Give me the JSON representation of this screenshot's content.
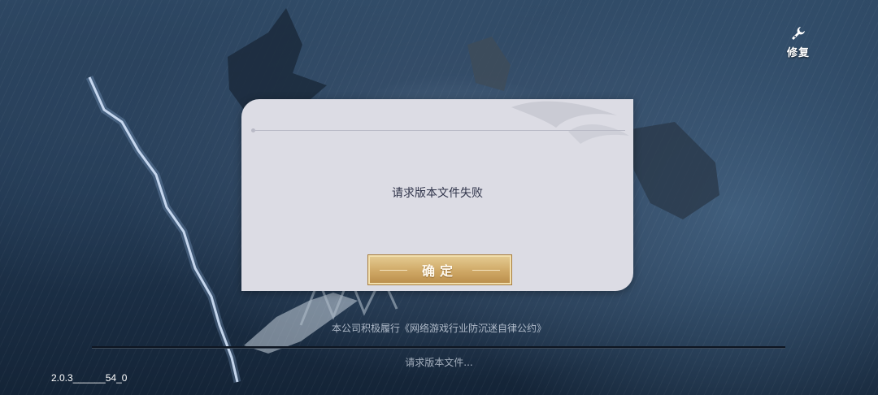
{
  "header": {
    "repair_label": "修复",
    "repair_icon": "wrench-icon"
  },
  "dialog": {
    "message": "请求版本文件失败",
    "confirm_label": "确定"
  },
  "footer": {
    "notice": "本公司积极履行《网络游戏行业防沉迷自律公约》",
    "status": "请求版本文件...",
    "version": "2.0.3______54_0"
  },
  "colors": {
    "dialog_bg": "#dcdce4",
    "button_gold": "#cfa866",
    "text_dark": "#30344a"
  }
}
